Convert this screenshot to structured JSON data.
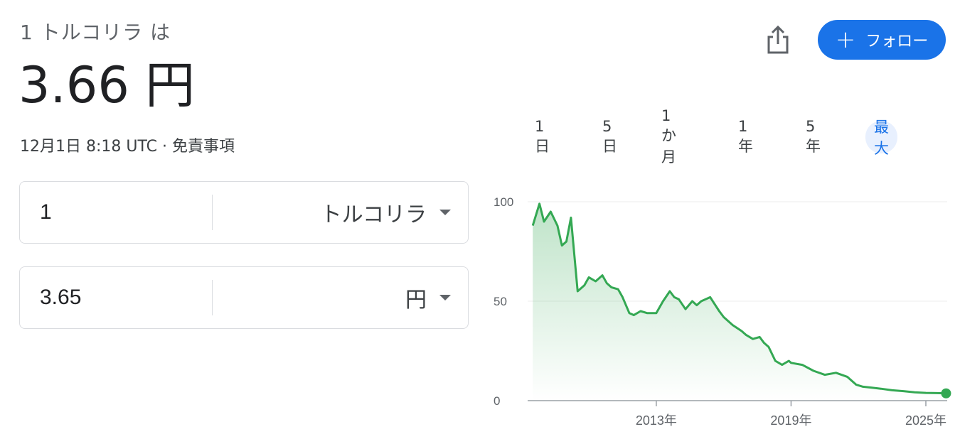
{
  "header": {
    "subtitle": "1 トルコリラ は",
    "rate": "3.66 円",
    "timestamp": "12月1日 8:18 UTC · ",
    "disclaimer": "免責事項"
  },
  "actions": {
    "share_icon": "share-icon",
    "follow_plus": "+",
    "follow_label": "フォロー"
  },
  "converter": {
    "from": {
      "amount": "1",
      "currency": "トルコリラ"
    },
    "to": {
      "amount": "3.65",
      "currency": "円"
    }
  },
  "ranges": [
    "1 日",
    "5 日",
    "1 か月",
    "1 年",
    "5 年",
    "最大"
  ],
  "active_range": "最大",
  "colors": {
    "accent": "#1a73e8",
    "line": "#34a853",
    "text": "#202124",
    "muted": "#5f6368"
  },
  "chart_data": {
    "type": "area",
    "y_ticks": [
      0,
      50,
      100
    ],
    "ylim": [
      0,
      100
    ],
    "x_ticks": [
      {
        "x": 2013.0,
        "label": "2013年"
      },
      {
        "x": 2019.0,
        "label": "2019年"
      },
      {
        "x": 2025.0,
        "label": "2025年"
      }
    ],
    "xlim": [
      2007.4,
      2025.95
    ],
    "grid": true,
    "series": [
      {
        "x": [
          2007.5,
          2007.8,
          2008.0,
          2008.3,
          2008.6,
          2008.8,
          2009.0,
          2009.2,
          2009.5,
          2009.8,
          2010.0,
          2010.3,
          2010.6,
          2010.8,
          2011.0,
          2011.3,
          2011.5,
          2011.8,
          2012.0,
          2012.3,
          2012.6,
          2013.0,
          2013.3,
          2013.6,
          2013.8,
          2014.0,
          2014.3,
          2014.6,
          2014.8,
          2015.0,
          2015.4,
          2015.8,
          2016.0,
          2016.4,
          2016.8,
          2017.0,
          2017.3,
          2017.6,
          2017.8,
          2018.0,
          2018.3,
          2018.6,
          2018.9,
          2019.0,
          2019.5,
          2020.0,
          2020.5,
          2021.0,
          2021.5,
          2021.9,
          2022.2,
          2022.6,
          2023.0,
          2023.5,
          2024.0,
          2024.5,
          2025.0,
          2025.5,
          2025.9
        ],
        "y": [
          88,
          99,
          90,
          95,
          88,
          78,
          80,
          92,
          55,
          58,
          62,
          60,
          63,
          59,
          57,
          56,
          52,
          44,
          43,
          45,
          44,
          44,
          50,
          55,
          52,
          51,
          46,
          50,
          48,
          50,
          52,
          45,
          42,
          38,
          35,
          33,
          31,
          32,
          29,
          27,
          20,
          18,
          20,
          19,
          18,
          15,
          13,
          14,
          12,
          8,
          7,
          6.5,
          6,
          5.2,
          4.8,
          4.2,
          3.9,
          3.8,
          3.66
        ]
      }
    ]
  }
}
